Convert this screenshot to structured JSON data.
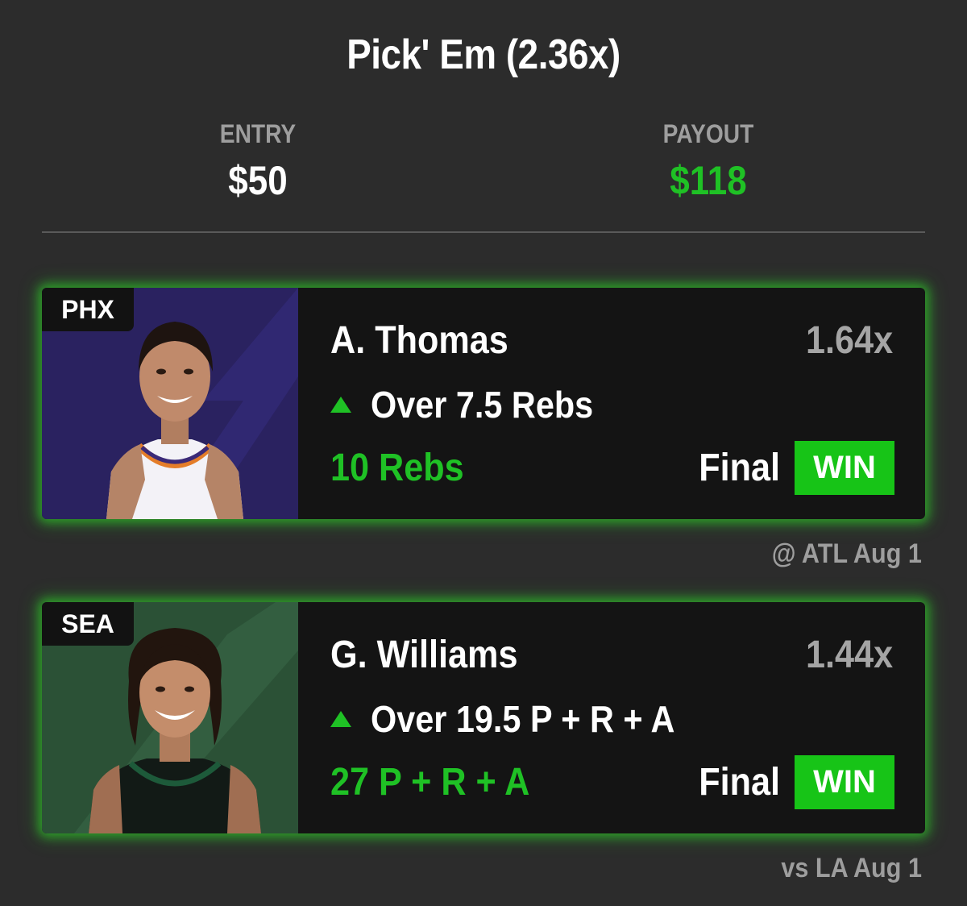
{
  "header": {
    "title": "Pick' Em (2.36x)",
    "entry_label": "ENTRY",
    "entry_value": "$50",
    "payout_label": "PAYOUT",
    "payout_value": "$118"
  },
  "picks": [
    {
      "team": "PHX",
      "player": "A. Thomas",
      "multiplier": "1.64x",
      "direction_icon": "up-triangle-icon",
      "pick": "Over 7.5 Rebs",
      "result": "10 Rebs",
      "status": "Final",
      "badge": "WIN",
      "game": "@ ATL Aug 1"
    },
    {
      "team": "SEA",
      "player": "G. Williams",
      "multiplier": "1.44x",
      "direction_icon": "up-triangle-icon",
      "pick": "Over 19.5 P + R + A",
      "result": "27 P + R + A",
      "status": "Final",
      "badge": "WIN",
      "game": "vs LA Aug 1"
    }
  ],
  "colors": {
    "background": "#2c2c2c",
    "card": "#141414",
    "accent_green": "#1fc125",
    "muted": "#9e9e9e",
    "phx_photo_bg": "#2a2260",
    "sea_photo_bg": "#2b5136"
  }
}
